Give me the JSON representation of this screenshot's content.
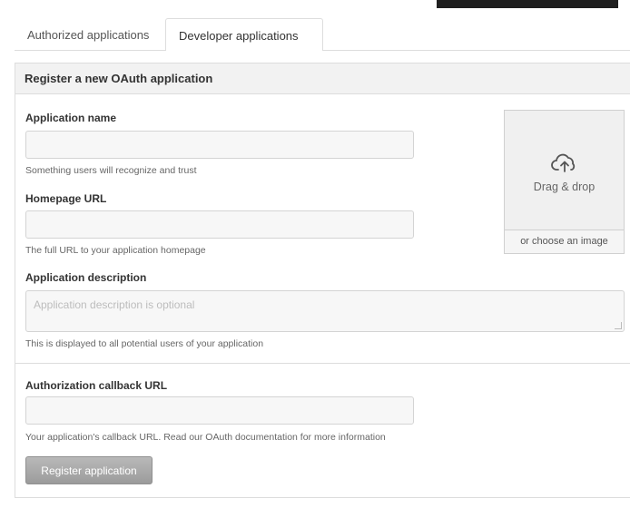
{
  "tabs": [
    {
      "label": "Authorized applications",
      "active": false
    },
    {
      "label": "Developer applications",
      "active": true
    }
  ],
  "panel": {
    "title": "Register a new OAuth application"
  },
  "form": {
    "app_name": {
      "label": "Application name",
      "value": "",
      "placeholder": "",
      "note": "Something users will recognize and trust"
    },
    "homepage": {
      "label": "Homepage URL",
      "value": "",
      "placeholder": "",
      "note": "The full URL to your application homepage"
    },
    "description": {
      "label": "Application description",
      "value": "",
      "placeholder": "Application description is optional",
      "note": "This is displayed to all potential users of your application"
    },
    "callback": {
      "label": "Authorization callback URL",
      "value": "",
      "placeholder": "",
      "note": "Your application's callback URL. Read our OAuth documentation for more information"
    },
    "submit_label": "Register application"
  },
  "dropzone": {
    "icon": "cloud-upload-icon",
    "text": "Drag & drop",
    "choose_label": "or choose an image"
  },
  "colors": {
    "button_bg": "#a9a9a9",
    "panel_header_bg": "#f2f2f2",
    "input_bg": "#f7f7f7",
    "dropzone_bg": "#f0f0f0"
  }
}
